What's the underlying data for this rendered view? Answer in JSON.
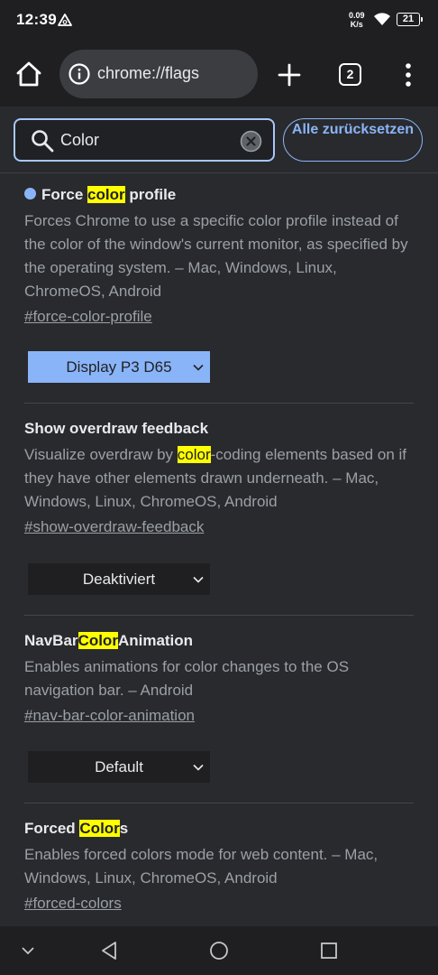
{
  "status_bar": {
    "time": "12:39",
    "speed_value": "0.09",
    "speed_unit": "K/s",
    "battery": "21"
  },
  "toolbar": {
    "url": "chrome://flags",
    "tab_count": "2"
  },
  "search": {
    "value": "Color",
    "reset_label": "Alle zurücksetzen"
  },
  "flags": [
    {
      "title_pre": "Force ",
      "title_hl": "color",
      "title_post": " profile",
      "description": "Forces Chrome to use a specific color profile instead of the color of the window's current monitor, as specified by the operating system. – Mac, Windows, Linux, ChromeOS, Android",
      "link": "#force-color-profile",
      "value": "Display P3 D65"
    },
    {
      "title": "Show overdraw feedback",
      "desc_pre": "Visualize overdraw by ",
      "desc_hl": "color",
      "desc_post": "-coding elements based on if they have other elements drawn underneath. – Mac, Windows, Linux, ChromeOS, Android",
      "link": "#show-overdraw-feedback",
      "value": "Deaktiviert"
    },
    {
      "title_pre": "NavBar",
      "title_hl": "Color",
      "title_post": "Animation",
      "description": "Enables animations for color changes to the OS navigation bar. – Android",
      "link": "#nav-bar-color-animation",
      "value": "Default"
    },
    {
      "title_pre": "Forced ",
      "title_hl": "Color",
      "title_post": "s",
      "description": "Enables forced colors mode for web content. – Mac, Windows, Linux, ChromeOS, Android",
      "link": "#forced-colors"
    }
  ],
  "colors": {
    "background": "#292a2d",
    "accent": "#8ab4f8",
    "highlight": "#ffff00"
  }
}
